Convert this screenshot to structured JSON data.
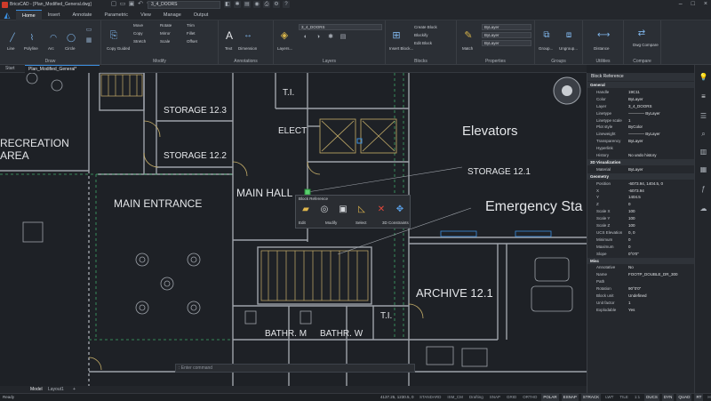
{
  "window": {
    "title": "BricsCAD - [Plan_Modified_General.dwg]",
    "current_layer": "3_4_DOORS",
    "controls": [
      "–",
      "□",
      "×"
    ]
  },
  "app_menu_icon": "bricscad-app-icon",
  "ribbon_tabs": [
    "Home",
    "Insert",
    "Annotate",
    "Parametric",
    "View",
    "Manage",
    "Output"
  ],
  "active_tab": "Home",
  "ribbon": {
    "draw": {
      "label": "Draw",
      "tools": [
        "Line",
        "Polyline",
        "Arc",
        "Circle"
      ]
    },
    "modify": {
      "label": "Modify",
      "big": "Copy Guided",
      "tools": [
        "Move",
        "Copy",
        "Stretch",
        "Rotate",
        "Mirror",
        "Scale",
        "Trim",
        "Fillet",
        "Offset"
      ]
    },
    "annotations": {
      "label": "Annotations",
      "tools": [
        "Text",
        "Dimension"
      ]
    },
    "layers": {
      "label": "Layers",
      "big": "Layers...",
      "combo": "3_4_DOORS"
    },
    "blocks": {
      "label": "Blocks",
      "big": "Insert Block...",
      "tools": [
        "Create Block",
        "Blockify",
        "Edit Block"
      ]
    },
    "properties": {
      "label": "Properties",
      "big": "Match",
      "combos": [
        "ByLayer",
        "ByLayer",
        "ByLayer"
      ]
    },
    "groups": {
      "label": "Groups",
      "tools": [
        "Group...",
        "Ungroup..."
      ]
    },
    "utilities": {
      "label": "Utilities",
      "tools": [
        "Distance"
      ]
    },
    "compare": {
      "label": "Compare",
      "tools": [
        "Dwg Compare"
      ]
    }
  },
  "doc_tabs": [
    "Start",
    "Plan_Modified_General*"
  ],
  "rooms": {
    "recreation_1": "RECREATION",
    "recreation_2": "AREA",
    "storage_123": "STORAGE 12.3",
    "storage_122": "STORAGE 12.2",
    "ti_top": "T.I.",
    "elect": "ELECT",
    "elevators": "Elevators",
    "storage_121": "STORAGE 12.1",
    "main_entrance": "MAIN ENTRANCE",
    "main_hall": "MAIN HALL",
    "emergency": "Emergency Sta",
    "archive": "ARCHIVE 12.1",
    "ti_bottom": "T.I.",
    "bathr_m": "BATHR. M",
    "bathr_w": "BATHR. W"
  },
  "quad": {
    "title": "Block Reference",
    "labels": [
      "Edit",
      "Modify",
      "Select",
      "3D Constraints"
    ],
    "icons": [
      "edit-folder-icon",
      "modify-icon",
      "select-icon",
      "constraint-icon",
      "delete-icon",
      "move-icon"
    ]
  },
  "command_line": {
    "placeholder": ": Enter command"
  },
  "layout_tabs": [
    "Model",
    "Layout1",
    "+"
  ],
  "properties_panel": {
    "title": "Block Reference",
    "rows": [
      {
        "cat": true,
        "k": "General",
        "v": ""
      },
      {
        "k": "Handle",
        "v": "19C11"
      },
      {
        "k": "Color",
        "v": "ByLayer"
      },
      {
        "k": "Layer",
        "v": "3_4_DOORS"
      },
      {
        "k": "Linetype",
        "v": "———— ByLayer"
      },
      {
        "k": "Linetype scale",
        "v": "1"
      },
      {
        "k": "Plot style",
        "v": "ByColor"
      },
      {
        "k": "Lineweight",
        "v": "———— ByLayer"
      },
      {
        "k": "Transparency",
        "v": "ByLayer"
      },
      {
        "k": "Hyperlink",
        "v": ""
      },
      {
        "k": "History",
        "v": "No undo history"
      },
      {
        "cat": true,
        "k": "3D Visualization",
        "v": ""
      },
      {
        "k": "Material",
        "v": "ByLayer"
      },
      {
        "cat": true,
        "k": "Geometry",
        "v": ""
      },
      {
        "k": "Position",
        "v": "-6073.94, 1404.5, 0"
      },
      {
        "k": "X",
        "v": "-6073.94"
      },
      {
        "k": "Y",
        "v": "1404.5"
      },
      {
        "k": "Z",
        "v": "0"
      },
      {
        "k": "Scale X",
        "v": "100"
      },
      {
        "k": "Scale Y",
        "v": "100"
      },
      {
        "k": "Scale Z",
        "v": "100"
      },
      {
        "k": "UCS Elevation",
        "v": "0, 0"
      },
      {
        "k": "Minimum",
        "v": "0"
      },
      {
        "k": "Maximum",
        "v": "0"
      },
      {
        "k": "Slope",
        "v": "0°0'0\""
      },
      {
        "cat": true,
        "k": "Misc",
        "v": ""
      },
      {
        "k": "Annotative",
        "v": "No"
      },
      {
        "k": "Name",
        "v": "FOOTP_DOUBLE_DR_300"
      },
      {
        "k": "Path",
        "v": ""
      },
      {
        "k": "Rotation",
        "v": "90°0'0\""
      },
      {
        "k": "Block unit",
        "v": "Undefined"
      },
      {
        "k": "Unit factor",
        "v": "1"
      },
      {
        "k": "Explodable",
        "v": "Yes"
      }
    ]
  },
  "sidebar_icons": [
    "lightbulb-icon",
    "layers-icon",
    "stack-icon",
    "attachment-icon",
    "library-icon",
    "grid-icon",
    "formula-icon",
    "cloud-icon"
  ],
  "status": {
    "ready": "Ready",
    "coords": "4137.25, 1230.5, 0",
    "toggles": [
      {
        "t": "STANDARD",
        "on": false
      },
      {
        "t": "ISM_CM",
        "on": false
      },
      {
        "t": "Drafting",
        "on": false
      },
      {
        "t": "SNAP",
        "on": false
      },
      {
        "t": "GRID",
        "on": false
      },
      {
        "t": "ORTHO",
        "on": false
      },
      {
        "t": "POLAR",
        "on": true
      },
      {
        "t": "ESNAP",
        "on": true
      },
      {
        "t": "STRACK",
        "on": true
      },
      {
        "t": "LWT",
        "on": false
      },
      {
        "t": "TILE",
        "on": false
      },
      {
        "t": "1:1",
        "on": false
      },
      {
        "t": "DUCS",
        "on": true
      },
      {
        "t": "DYN",
        "on": true
      },
      {
        "t": "QUAD",
        "on": true
      },
      {
        "t": "RT",
        "on": true
      },
      {
        "t": "HKA",
        "on": false
      },
      {
        "t": "None",
        "on": false
      }
    ]
  },
  "colors": {
    "accent": "#3b8fe0",
    "wall": "#9ea3aa",
    "stair": "#c8b06a",
    "dashed": "#3fa86a",
    "selection": "#3b8fe0"
  }
}
